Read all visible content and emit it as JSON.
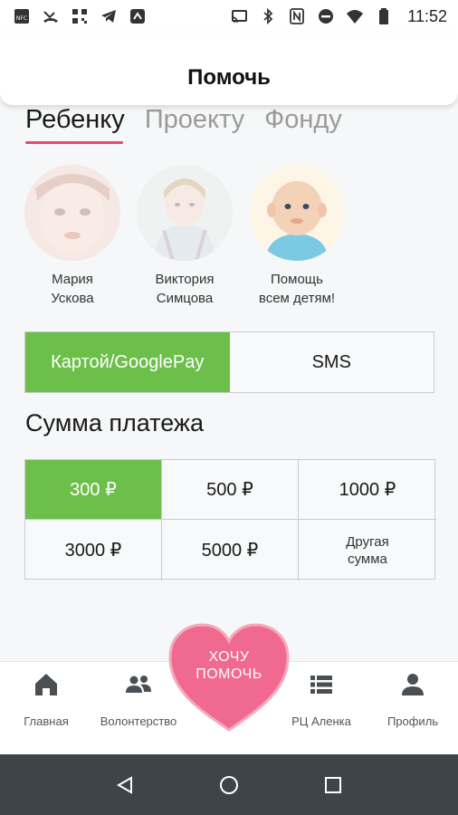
{
  "status_bar": {
    "time": "11:52",
    "left_icons": [
      "nfc-icon",
      "missed-call-icon",
      "qr-icon",
      "telegram-icon",
      "app-icon"
    ],
    "right_icons": [
      "cast-icon",
      "bluetooth-icon",
      "nfc-n-icon",
      "dnd-icon",
      "wifi-icon",
      "battery-icon"
    ]
  },
  "header": {
    "title": "Помочь"
  },
  "tabs": [
    {
      "label": "Ребенку",
      "active": true
    },
    {
      "label": "Проекту",
      "active": false
    },
    {
      "label": "Фонду",
      "active": false
    }
  ],
  "children": [
    {
      "name": "Мария\nУскова"
    },
    {
      "name": "Виктория\nСимцова"
    },
    {
      "name": "Помощь\nвсем детям!"
    }
  ],
  "payment_method": {
    "card_label": "Картой/GooglePay",
    "sms_label": "SMS",
    "selected": "card"
  },
  "sum": {
    "title": "Сумма платежа",
    "options": [
      "300 ₽",
      "500 ₽",
      "1000 ₽",
      "3000 ₽",
      "5000 ₽",
      "Другая\nсумма"
    ],
    "selected": "300 ₽"
  },
  "help_button": {
    "label": "ХОЧУ\nПОМОЧЬ"
  },
  "bottom_nav": [
    {
      "label": "Главная",
      "icon": "home-icon"
    },
    {
      "label": "Волонтерство",
      "icon": "people-icon"
    },
    {
      "label": "РЦ Аленка",
      "icon": "list-icon"
    },
    {
      "label": "Профиль",
      "icon": "person-icon"
    }
  ],
  "colors": {
    "accent_green": "#6cbf4a",
    "accent_pink": "#e84a6a",
    "heart": "#ef6a8e"
  }
}
